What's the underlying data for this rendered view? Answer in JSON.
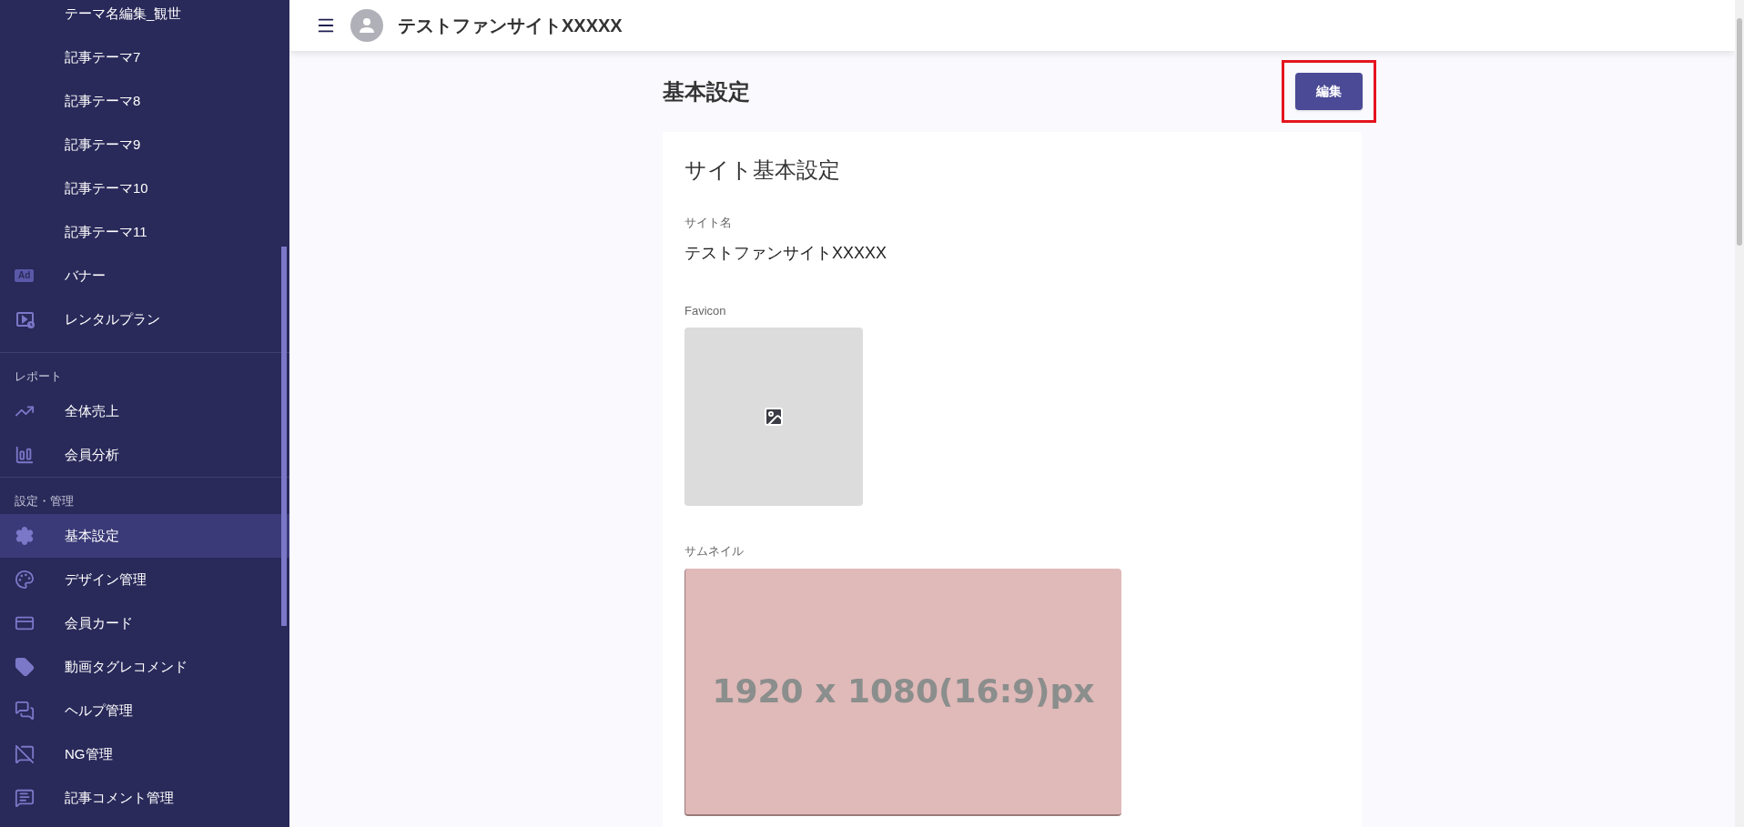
{
  "header": {
    "title": "テストファンサイトXXXXX"
  },
  "sidebar": {
    "sections": [
      {
        "items": [
          {
            "kind": "sub",
            "label": "テーマ名編集_観世",
            "selected": false
          },
          {
            "kind": "sub",
            "label": "記事テーマ7",
            "selected": false
          },
          {
            "kind": "sub",
            "label": "記事テーマ8",
            "selected": false
          },
          {
            "kind": "sub",
            "label": "記事テーマ9",
            "selected": false
          },
          {
            "kind": "sub",
            "label": "記事テーマ10",
            "selected": false
          },
          {
            "kind": "sub",
            "label": "記事テーマ11",
            "selected": false
          },
          {
            "kind": "badge",
            "badge": "Ad",
            "label": "バナー",
            "selected": false
          },
          {
            "kind": "icon",
            "label": "レンタルプラン",
            "selected": false
          }
        ]
      },
      {
        "header": "レポート",
        "items": [
          {
            "kind": "icon",
            "label": "全体売上",
            "selected": false
          },
          {
            "kind": "icon",
            "label": "会員分析",
            "selected": false
          }
        ]
      },
      {
        "header": "設定・管理",
        "items": [
          {
            "kind": "icon",
            "label": "基本設定",
            "selected": true
          },
          {
            "kind": "icon",
            "label": "デザイン管理",
            "selected": false
          },
          {
            "kind": "icon",
            "label": "会員カード",
            "selected": false
          },
          {
            "kind": "icon",
            "label": "動画タグレコメンド",
            "selected": false
          },
          {
            "kind": "icon",
            "label": "ヘルプ管理",
            "selected": false
          },
          {
            "kind": "icon",
            "label": "NG管理",
            "selected": false
          },
          {
            "kind": "icon",
            "label": "記事コメント管理",
            "selected": false
          }
        ]
      }
    ]
  },
  "page": {
    "title": "基本設定",
    "edit_button": {
      "label": "編集",
      "highlighted": true
    }
  },
  "card": {
    "title": "サイト基本設定",
    "site_name": {
      "label": "サイト名",
      "value": "テストファンサイトXXXXX"
    },
    "favicon": {
      "label": "Favicon"
    },
    "thumbnail": {
      "label": "サムネイル",
      "placeholder_text": "1920 x 1080(16:9)px"
    }
  }
}
